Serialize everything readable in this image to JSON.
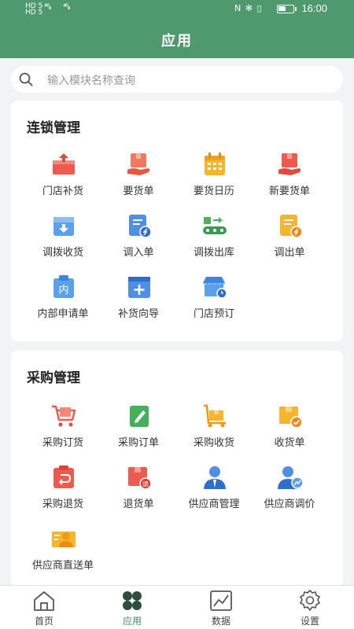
{
  "status_bar": {
    "left_top": "HD 5",
    "left_bottom": "HD 5",
    "signal_1": "⁴⁶ᵢₗₗ",
    "signal_2": "⁴⁶ᵢₗₗ",
    "icons": "N ✻ ▯",
    "battery_level": 0.55,
    "time": "16:00"
  },
  "header": {
    "title": "应用"
  },
  "search": {
    "placeholder": "输入模块名称查询"
  },
  "sections": [
    {
      "title": "连锁管理",
      "items": [
        {
          "label": "门店补货",
          "icon": "box-upload-icon"
        },
        {
          "label": "要货单",
          "icon": "box-hand-icon"
        },
        {
          "label": "要货日历",
          "icon": "calendar-icon"
        },
        {
          "label": "新要货单",
          "icon": "box-hand-new-icon"
        },
        {
          "label": "调拨收货",
          "icon": "box-download-icon"
        },
        {
          "label": "调入单",
          "icon": "transfer-in-doc-icon"
        },
        {
          "label": "调拨出库",
          "icon": "conveyor-icon"
        },
        {
          "label": "调出单",
          "icon": "transfer-out-doc-icon"
        },
        {
          "label": "内部申请单",
          "icon": "internal-request-icon"
        },
        {
          "label": "补货向导",
          "icon": "replenish-wizard-icon"
        },
        {
          "label": "门店预订",
          "icon": "store-booking-icon"
        }
      ]
    },
    {
      "title": "采购管理",
      "items": [
        {
          "label": "采购订货",
          "icon": "cart-icon"
        },
        {
          "label": "采购订单",
          "icon": "order-edit-icon"
        },
        {
          "label": "采购收货",
          "icon": "trolley-icon"
        },
        {
          "label": "收货单",
          "icon": "receipt-check-icon"
        },
        {
          "label": "采购退货",
          "icon": "return-icon"
        },
        {
          "label": "退货单",
          "icon": "return-doc-icon"
        },
        {
          "label": "供应商管理",
          "icon": "supplier-icon"
        },
        {
          "label": "供应商调价",
          "icon": "supplier-price-icon"
        },
        {
          "label": "供应商直送单",
          "icon": "direct-delivery-icon"
        }
      ]
    }
  ],
  "tabbar": [
    {
      "label": "首页",
      "icon": "home-icon"
    },
    {
      "label": "应用",
      "icon": "apps-icon",
      "active": true
    },
    {
      "label": "数据",
      "icon": "chart-icon"
    },
    {
      "label": "设置",
      "icon": "settings-icon"
    }
  ],
  "colors": {
    "brand": "#4e9a6e",
    "active_tab": "#3c8d5f"
  }
}
